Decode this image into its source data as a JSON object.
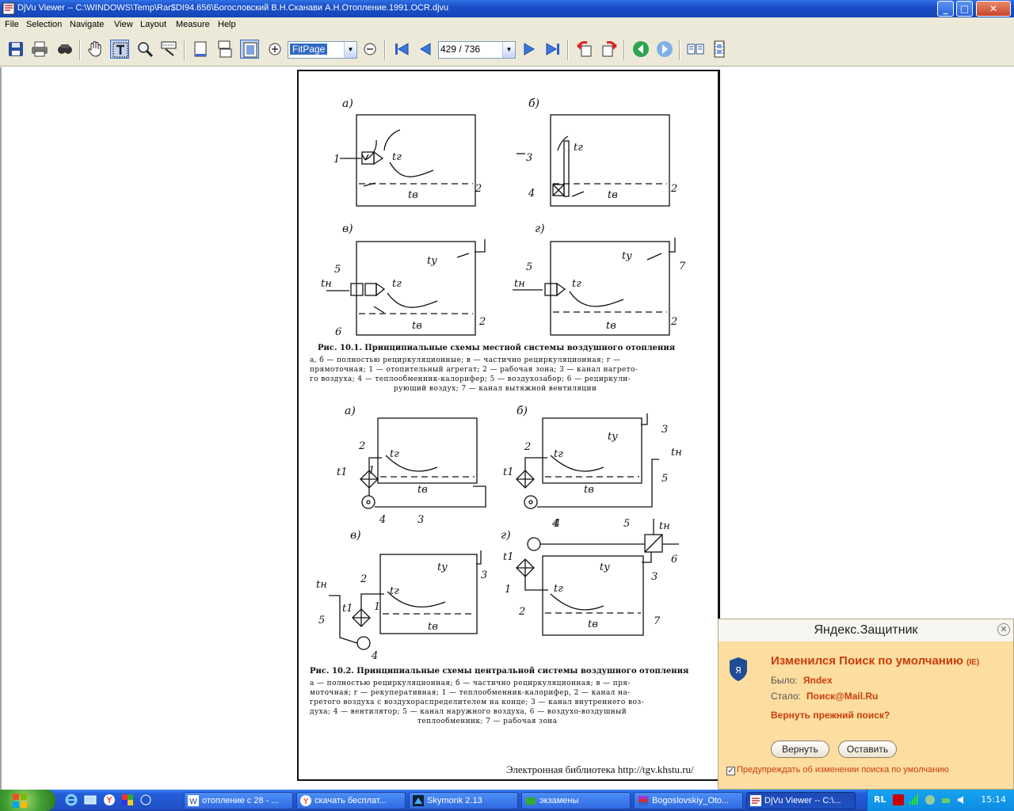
{
  "window": {
    "title": "DjVu Viewer -- C:\\WINDOWS\\Temp\\Rar$DI94.656\\Богословский В.Н.Сканави А.Н.Отопление.1991.OCR.djvu",
    "minimize": "_",
    "maximize": "□",
    "close": "✕"
  },
  "menu": [
    "File",
    "Selection",
    "Navigate",
    "View",
    "Layout",
    "Measure",
    "Help"
  ],
  "toolbar": {
    "zoom_value": "FitPage",
    "page_value": "429 / 736",
    "icons": [
      "save-icon",
      "print-icon",
      "find-icon",
      "hand-icon",
      "text-select-icon",
      "zoom-rect-icon",
      "region-select-icon",
      "single-page-icon",
      "continuous-page-icon",
      "fit-page-icon",
      "zoom-in-icon",
      "zoom-out-icon",
      "first-page-icon",
      "prev-page-icon",
      "next-page-icon",
      "last-page-icon",
      "rotate-left-icon",
      "rotate-right-icon",
      "back-icon",
      "forward-icon",
      "book-icon",
      "film-icon"
    ]
  },
  "document": {
    "fig1": {
      "panel_a": "а)",
      "panel_b": "б)",
      "panel_v": "в)",
      "panel_g": "г)",
      "labels": {
        "tg": "tг",
        "tv": "tв",
        "ty": "tу",
        "tn": "tн",
        "n1": "1",
        "n2": "2",
        "n3": "3",
        "n4": "4",
        "n5": "5",
        "n6": "6",
        "n7": "7"
      }
    },
    "fig1_caption": "Рис. 10.1. Принципиальные схемы местной системы воздушного отопления",
    "fig1_lines": [
      "а, б — полностью рециркуляционные; в — частично рециркуляционная; г —",
      "прямоточная; 1 — отопительный агрегат; 2 — рабочая зона; 3 — канал нагрето-",
      "го воздуха; 4 — теплообменник-калорифер; 5 — воздухозабор; 6 — рециркули-",
      "рующий воздух; 7 — канал вытяжной вентиляции"
    ],
    "fig2": {
      "panel_a": "а)",
      "panel_b": "б)",
      "panel_v": "в)",
      "panel_g": "г)",
      "labels": {
        "t1": "t1"
      }
    },
    "fig2_caption": "Рис. 10.2. Принципиальные схемы центральной системы воздушного отопления",
    "fig2_lines": [
      "а — полностью рециркуляционная; б — частично рециркуляционная; в — пря-",
      "моточная; г — рекуперативная; 1 — теплообменник-калорифер, 2 — канал на-",
      "гретого воздуха с воздухораспределителем на конце; 3 — канал внутреннего воз-",
      "духа; 4 — вентилятор; 5 — канал наружного воздуха, 6 — воздухо-воздушный",
      "теплообменник; 7 — рабочая зона"
    ],
    "footer": "Электронная библиотека http://tgv.khstu.ru/"
  },
  "yandex_popup": {
    "title": "Яндекс.Защитник",
    "heading": "Изменился Поиск по умолчанию",
    "heading_tag": "(IE)",
    "was_label": "Было:",
    "was_value": "Яndex",
    "now_label": "Стало:",
    "now_value": "Поиск@Mail.Ru",
    "question": "Вернуть прежний поиск?",
    "return_button": "Вернуть",
    "keep_button": "Оставить",
    "checkbox_label": "Предупреждать об изменении поиска по умолчанию",
    "checkbox_checked": true,
    "close": "✕"
  },
  "taskbar": {
    "tasks": [
      {
        "label": "отопление с 28 - ...",
        "icon": "word-icon"
      },
      {
        "label": "скачать бесплат...",
        "icon": "yandex-browser-icon"
      },
      {
        "label": "Skymonk 2.13",
        "icon": "skymonk-icon"
      },
      {
        "label": "экзамены",
        "icon": "folder-icon"
      },
      {
        "label": "Bogoslovskiy_Oto...",
        "icon": "winrar-icon"
      },
      {
        "label": "DjVu Viewer -- C:\\...",
        "icon": "djvu-icon",
        "active": true
      }
    ],
    "language": "RL",
    "clock": "15:14"
  }
}
